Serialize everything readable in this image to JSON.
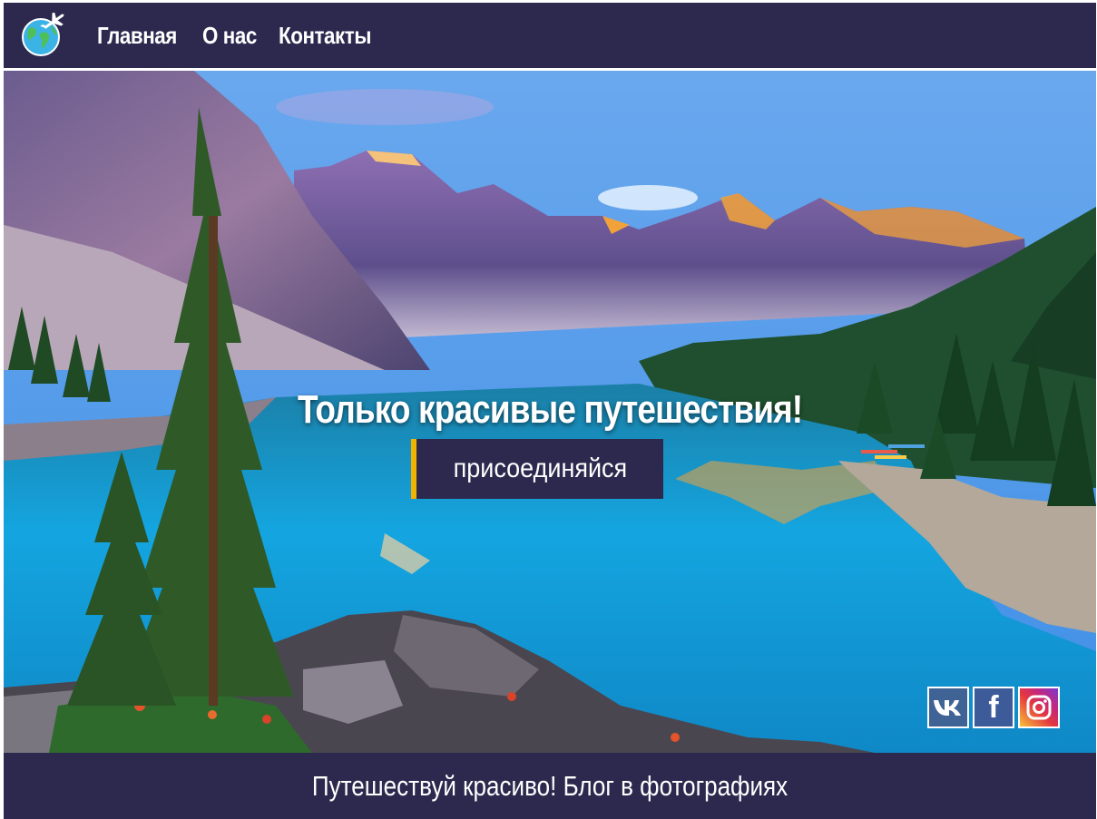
{
  "header": {
    "logo_icon": "globe-airplane-icon",
    "nav": [
      {
        "label": "Главная"
      },
      {
        "label": "О нас"
      },
      {
        "label": "Контакты"
      }
    ]
  },
  "hero": {
    "title": "Только красивые путешествия!",
    "button_label": "присоединяйся",
    "social": [
      {
        "icon": "vk-icon",
        "label": "vk"
      },
      {
        "icon": "facebook-icon",
        "label": "f"
      },
      {
        "icon": "instagram-icon"
      }
    ]
  },
  "footer": {
    "text": "Путешествуй красиво! Блог в фотографиях"
  },
  "colors": {
    "brand": "#2d294e",
    "accent": "#f2b300",
    "text": "#ffffff"
  }
}
